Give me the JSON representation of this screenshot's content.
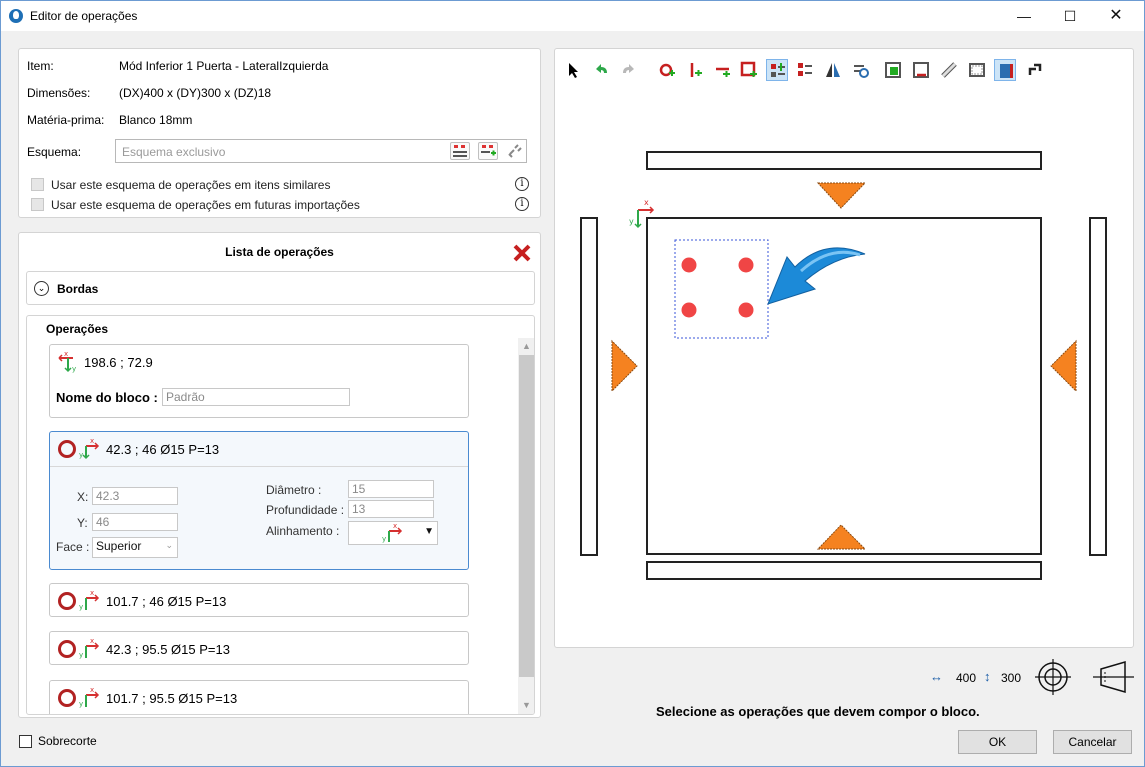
{
  "window": {
    "title": "Editor de operações"
  },
  "info": {
    "item_label": "Item:",
    "item_value": "Mód Inferior 1 Puerta - LateralIzquierda",
    "dim_label": "Dimensões:",
    "dim_value": "(DX)400 x (DY)300 x (DZ)18",
    "mat_label": "Matéria-prima:",
    "mat_value": "Blanco 18mm",
    "schema_label": "Esquema:",
    "schema_placeholder": "Esquema exclusivo",
    "check1": "Usar este esquema de operações em itens similares",
    "check2": "Usar este esquema de operações em futuras importações"
  },
  "ops": {
    "title": "Lista de operações",
    "bordas": "Bordas",
    "operacoes": "Operações",
    "block": {
      "coords": "198.6 ; 72.9",
      "name_label": "Nome do bloco :",
      "name_value": "Padrão"
    },
    "selected": {
      "summary": "42.3 ; 46 Ø15 P=13",
      "x_label": "X:",
      "x_value": "42.3",
      "y_label": "Y:",
      "y_value": "46",
      "face_label": "Face :",
      "face_value": "Superior",
      "diam_label": "Diâmetro :",
      "diam_value": "15",
      "prof_label": "Profundidade :",
      "prof_value": "13",
      "align_label": "Alinhamento :"
    },
    "items": [
      "101.7 ; 46 Ø15 P=13",
      "42.3 ; 95.5 Ø15 P=13",
      "101.7 ; 95.5 Ø15 P=13"
    ]
  },
  "canvas": {
    "width_value": "400",
    "height_value": "300",
    "accent_orange": "#f58220",
    "hole_red": "#f04545",
    "axis_x_color": "#d63030",
    "axis_y_color": "#2ea84a"
  },
  "footer": {
    "status": "Selecione as operações que devem compor o bloco.",
    "sobrecorte": "Sobrecorte",
    "ok": "OK",
    "cancel": "Cancelar"
  }
}
